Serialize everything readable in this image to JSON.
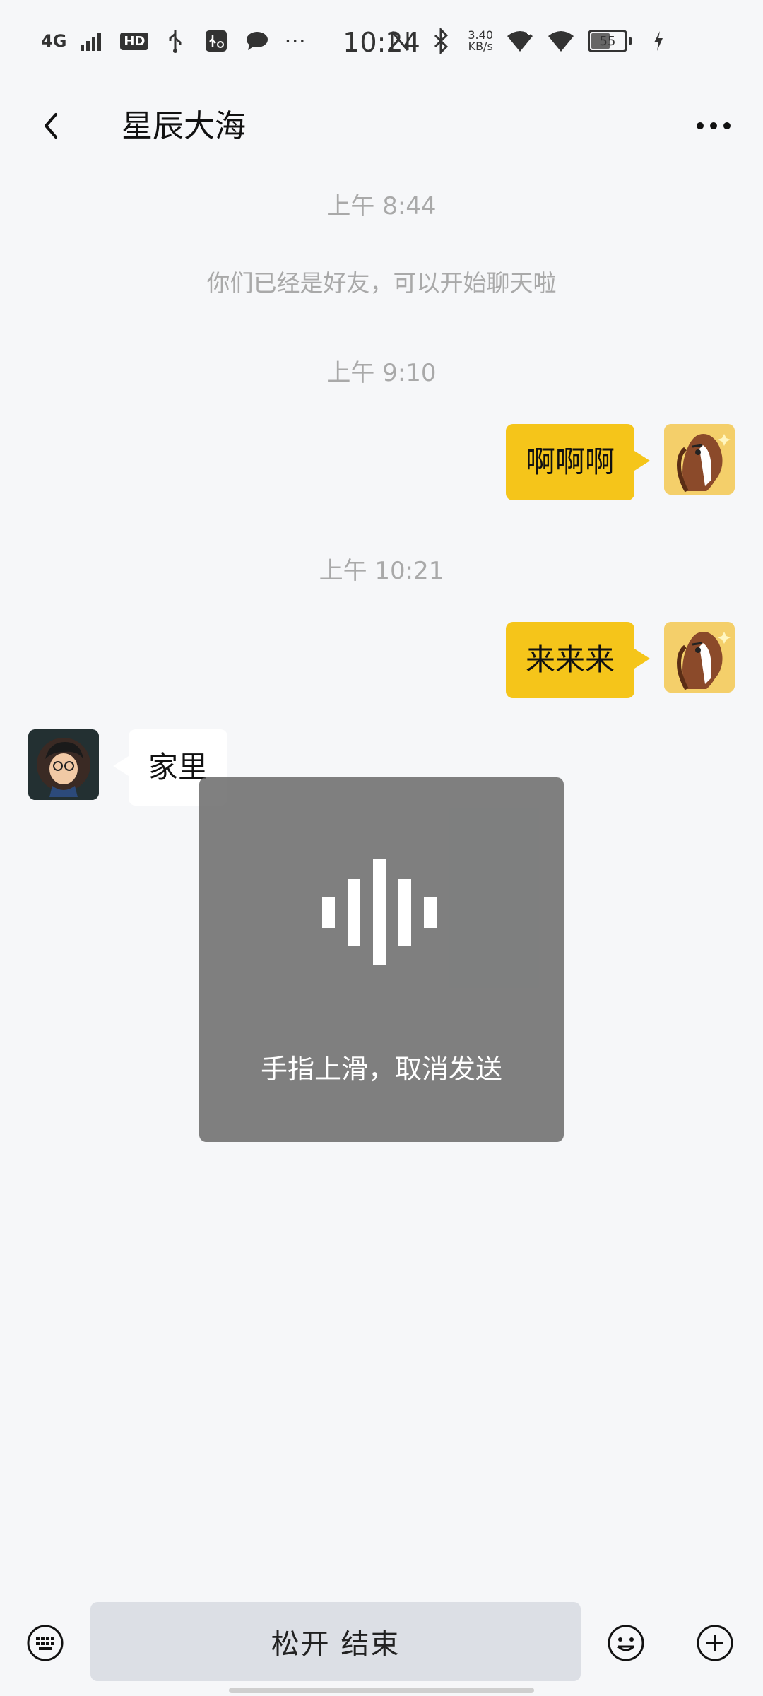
{
  "status_bar": {
    "network": "4G",
    "hd": "HD",
    "time": "10:24",
    "speed_value": "3.40",
    "speed_unit": "KB/s",
    "battery": "55",
    "more_dots": "···"
  },
  "header": {
    "title": "星辰大海"
  },
  "chat": {
    "timestamps": [
      "上午 8:44",
      "上午 9:10",
      "上午 10:21"
    ],
    "system_message": "你们已经是好友，可以开始聊天啦",
    "messages": [
      {
        "side": "right",
        "text": "啊啊啊"
      },
      {
        "side": "right",
        "text": "来来来"
      },
      {
        "side": "left",
        "text": "家里"
      }
    ]
  },
  "voice_overlay": {
    "hint": "手指上滑，取消发送"
  },
  "bottom_bar": {
    "hold_label": "松开 结束"
  },
  "icons": {
    "back": "chevron-left-icon",
    "more": "more-horizontal-icon",
    "keyboard": "keyboard-icon",
    "emoji": "emoji-icon",
    "plus": "plus-icon",
    "voice": "voice-wave-icon"
  },
  "colors": {
    "sent_bubble": "#f5c51a",
    "received_bubble": "#ffffff",
    "background": "#f6f7f9",
    "timestamp_text": "#a9a9a9",
    "overlay_bg": "#646464"
  }
}
